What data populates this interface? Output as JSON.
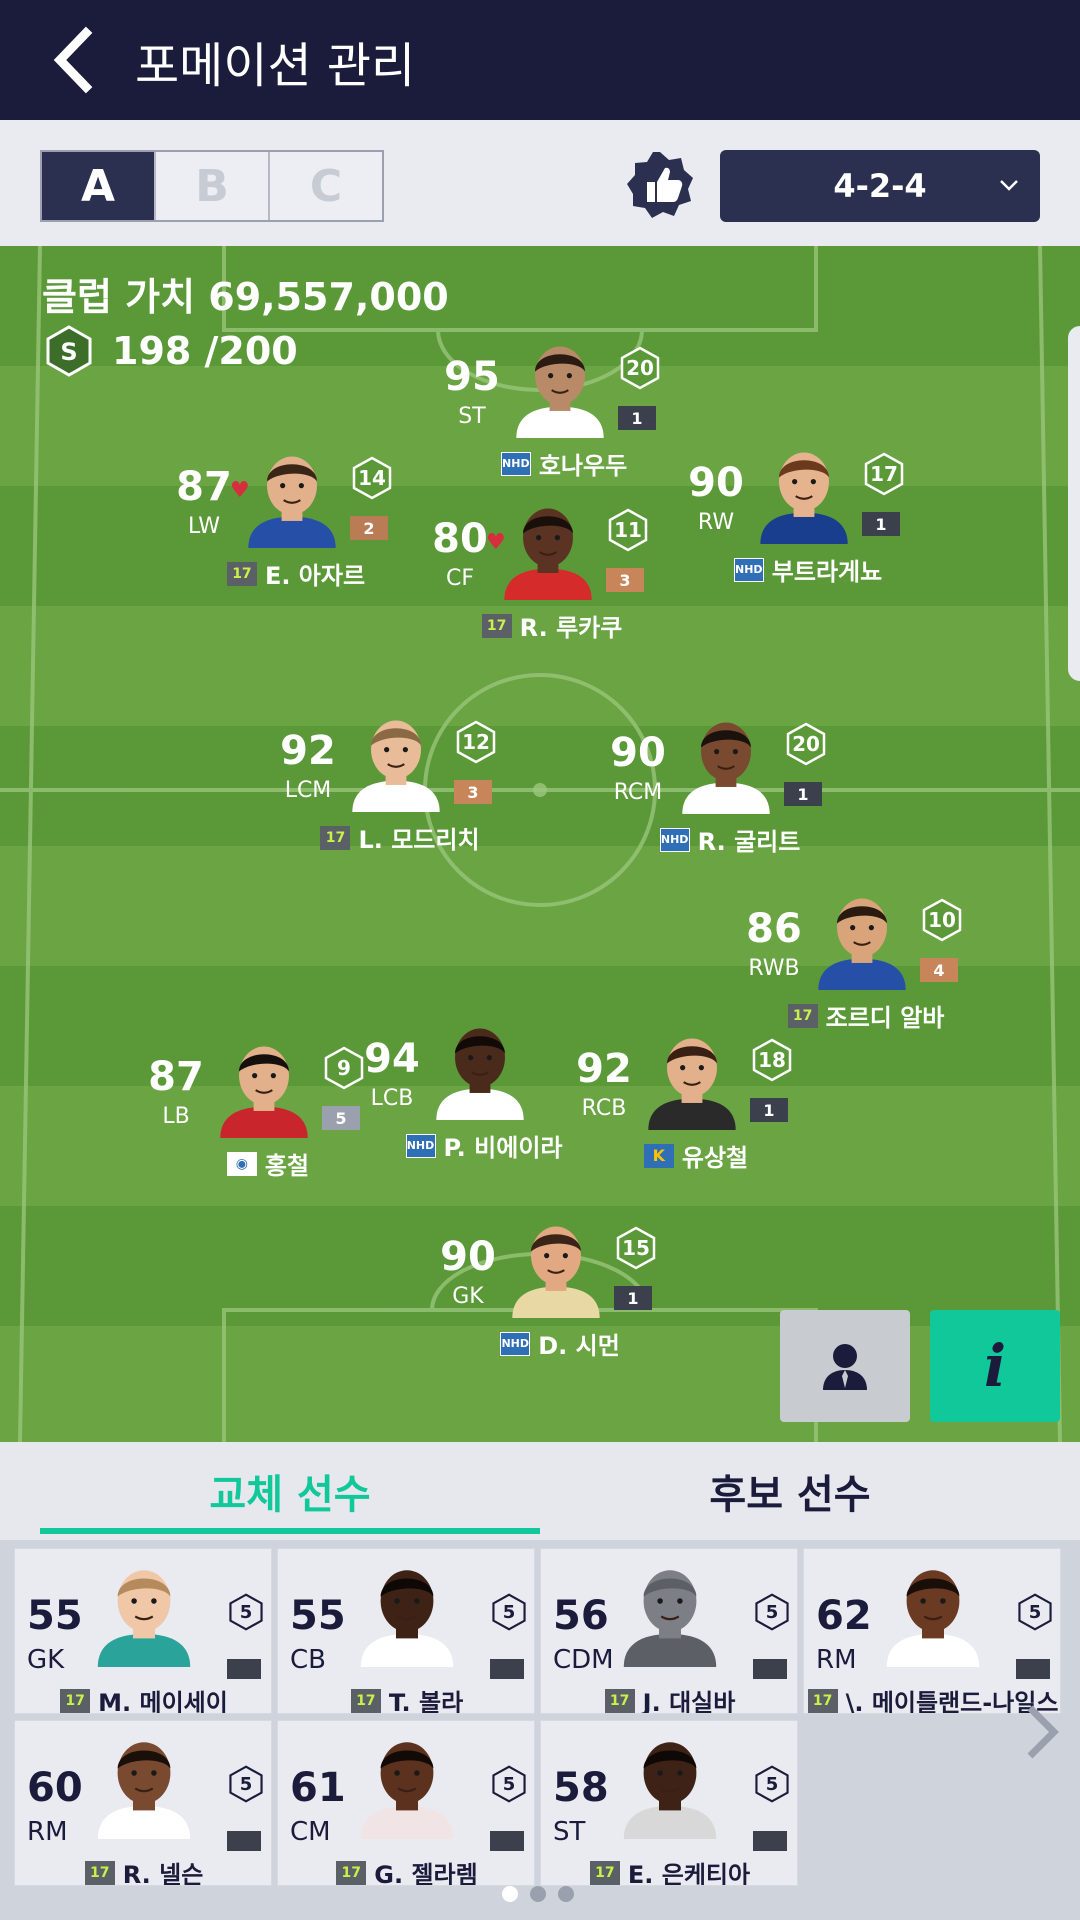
{
  "header": {
    "title": "포메이션 관리"
  },
  "toolbar": {
    "tabs": [
      "A",
      "B",
      "C"
    ],
    "active_tab": "A",
    "formation": "4-2-4"
  },
  "pitch": {
    "club_value_label": "클럽 가치 69,557,000",
    "squad_icon": "S",
    "squad_cost": "198 /200"
  },
  "players": [
    {
      "ovr": "95",
      "pos": "ST",
      "badge": "20",
      "enh": "1",
      "enh_color": "#3c404c",
      "season": "NHD",
      "name": "호나우두",
      "skin": "#b98a68",
      "hair": "#2b1b12",
      "shirt": "#ffffff",
      "fav": false
    },
    {
      "ovr": "87",
      "pos": "LW",
      "badge": "14",
      "enh": "2",
      "enh_color": "#b97c55",
      "season": "17",
      "name": "E. 아자르",
      "skin": "#e2b08a",
      "hair": "#3a2516",
      "shirt": "#2650a8",
      "fav": true
    },
    {
      "ovr": "80",
      "pos": "CF",
      "badge": "11",
      "enh": "3",
      "enh_color": "#c8855a",
      "season": "17",
      "name": "R. 루카쿠",
      "skin": "#5a3322",
      "hair": "#1a100b",
      "shirt": "#d52b2b",
      "fav": true
    },
    {
      "ovr": "90",
      "pos": "RW",
      "badge": "17",
      "enh": "1",
      "enh_color": "#3c404c",
      "season": "NHD",
      "name": "부트라게뇨",
      "skin": "#e5b48f",
      "hair": "#6b3a1c",
      "shirt": "#1a3e8e",
      "fav": false
    },
    {
      "ovr": "92",
      "pos": "LCM",
      "badge": "12",
      "enh": "3",
      "enh_color": "#c8855a",
      "season": "17",
      "name": "L. 모드리치",
      "skin": "#e8bc98",
      "hair": "#8a6a44",
      "shirt": "#ffffff",
      "fav": false
    },
    {
      "ovr": "90",
      "pos": "RCM",
      "badge": "20",
      "enh": "1",
      "enh_color": "#3c404c",
      "season": "NHD",
      "name": "R. 굴리트",
      "skin": "#7a4a30",
      "hair": "#1a120c",
      "shirt": "#ffffff",
      "fav": false
    },
    {
      "ovr": "86",
      "pos": "RWB",
      "badge": "10",
      "enh": "4",
      "enh_color": "#c8855a",
      "season": "17",
      "name": "조르디 알바",
      "skin": "#d9a479",
      "hair": "#2a1a10",
      "shirt": "#2650a8",
      "fav": false
    },
    {
      "ovr": "87",
      "pos": "LB",
      "badge": "9",
      "enh": "5",
      "enh_color": "#9aa0ad",
      "season": "KO",
      "name": "홍철",
      "skin": "#e2b08a",
      "hair": "#15100c",
      "shirt": "#c8262c",
      "fav": false
    },
    {
      "ovr": "94",
      "pos": "LCB",
      "badge": "",
      "enh": "",
      "enh_color": "#3c404c",
      "season": "NHD",
      "name": "P. 비에이라",
      "skin": "#4a2a1a",
      "hair": "#120a06",
      "shirt": "#ffffff",
      "fav": false
    },
    {
      "ovr": "92",
      "pos": "RCB",
      "badge": "18",
      "enh": "1",
      "enh_color": "#3c404c",
      "season": "K",
      "name": "유상철",
      "skin": "#e2b08a",
      "hair": "#3a2014",
      "shirt": "#2a2a2a",
      "fav": false
    },
    {
      "ovr": "90",
      "pos": "GK",
      "badge": "15",
      "enh": "1",
      "enh_color": "#3c404c",
      "season": "NHD",
      "name": "D. 시먼",
      "skin": "#e2a882",
      "hair": "#3a2418",
      "shirt": "#e8d9a4",
      "fav": false
    }
  ],
  "buttons": {
    "info_label": "i"
  },
  "bench_tabs": {
    "subs": "교체 선수",
    "reserves": "후보 선수"
  },
  "bench": [
    {
      "ovr": "55",
      "pos": "GK",
      "badge": "5",
      "season": "17",
      "name": "M. 메이세이",
      "skin": "#f0c8a8",
      "hair": "#b58a5c",
      "shirt": "#2aa39a"
    },
    {
      "ovr": "55",
      "pos": "CB",
      "badge": "5",
      "season": "17",
      "name": "T. 볼라",
      "skin": "#3e2216",
      "hair": "#0e0806",
      "shirt": "#ffffff"
    },
    {
      "ovr": "56",
      "pos": "CDM",
      "badge": "5",
      "season": "17",
      "name": "J. 대실바",
      "skin": "#7c7f86",
      "hair": "#5c5f66",
      "shirt": "#5c5f66"
    },
    {
      "ovr": "62",
      "pos": "RM",
      "badge": "5",
      "season": "17",
      "name": "\\. 메이틀랜드-나일스",
      "skin": "#6a3a22",
      "hair": "#1a0e08",
      "shirt": "#ffffff"
    },
    {
      "ovr": "60",
      "pos": "RM",
      "badge": "5",
      "season": "17",
      "name": "R. 넬슨",
      "skin": "#7a4a30",
      "hair": "#1a100a",
      "shirt": "#ffffff"
    },
    {
      "ovr": "61",
      "pos": "CM",
      "badge": "5",
      "season": "17",
      "name": "G. 젤라렘",
      "skin": "#5c321e",
      "hair": "#120a06",
      "shirt": "#f0e4e4"
    },
    {
      "ovr": "58",
      "pos": "ST",
      "badge": "5",
      "season": "17",
      "name": "E. 은케티아",
      "skin": "#3e2216",
      "hair": "#0e0806",
      "shirt": "#d8d8d8"
    }
  ],
  "pager": {
    "pages": 3,
    "active": 0
  },
  "colors": {
    "header": "#1b1b3b",
    "accent": "#10c89a",
    "pitch": "#5b9938",
    "panel": "#2c3050"
  }
}
